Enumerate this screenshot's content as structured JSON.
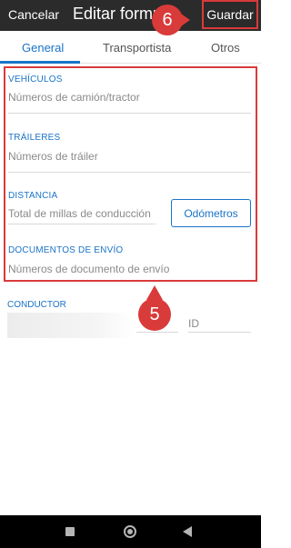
{
  "header": {
    "cancel_label": "Cancelar",
    "title": "Editar formulario",
    "save_label": "Guardar"
  },
  "tabs": [
    {
      "label": "General",
      "active": true
    },
    {
      "label": "Transportista",
      "active": false
    },
    {
      "label": "Otros",
      "active": false
    }
  ],
  "form": {
    "vehicles": {
      "label": "VEHÍCULOS",
      "placeholder": "Números de camión/tractor"
    },
    "trailers": {
      "label": "TRÁILERES",
      "placeholder": "Números de tráiler"
    },
    "distance": {
      "label": "DISTANCIA",
      "placeholder": "Total de millas de conducción",
      "odometer_button": "Odómetros"
    },
    "shipping_docs": {
      "label": "DOCUMENTOS DE ENVÍO",
      "placeholder": "Números de documento de envío"
    },
    "driver": {
      "label": "CONDUCTOR",
      "id_placeholder": "ID"
    }
  },
  "callouts": {
    "save": "6",
    "fields": "5"
  },
  "colors": {
    "accent": "#1a73c7",
    "callout": "#d93a3a",
    "topbar": "#2b2b2b"
  },
  "icons": [
    "recent-apps-icon",
    "home-icon",
    "back-icon"
  ]
}
